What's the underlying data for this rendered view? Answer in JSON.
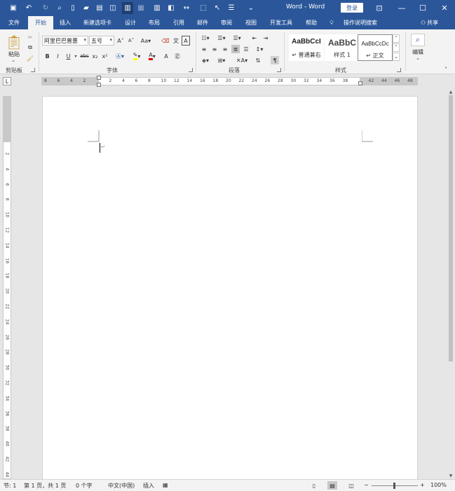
{
  "title_bar": {
    "title": "Word - Word",
    "login_label": "登录",
    "window_buttons": [
      "ribbon-display-options",
      "minimize",
      "maximize",
      "close"
    ]
  },
  "quick_access": [
    "save",
    "undo",
    "redo",
    "print-preview",
    "new",
    "open",
    "paste-special",
    "copy-format",
    "layout",
    "show-hide",
    "columns",
    "page-setup",
    "width",
    "select",
    "cursor",
    "list",
    "more"
  ],
  "tabs": {
    "file": "文件",
    "home": "开始",
    "insert": "插入",
    "new_tab": "新建选项卡",
    "design": "设计",
    "layout": "布局",
    "references": "引用",
    "mailings": "邮件",
    "review": "审阅",
    "view": "视图",
    "developer": "开发工具",
    "help": "帮助",
    "tell_me": "操作说明搜索",
    "share": "共享"
  },
  "ribbon": {
    "clipboard": {
      "label": "剪贴板",
      "paste_label": "粘贴"
    },
    "font": {
      "label": "字体",
      "font_name": "阿里巴巴普惠",
      "font_size": "五号",
      "case_label": "Aa",
      "bold": "B",
      "italic": "I",
      "underline": "U",
      "strike": "abc",
      "subscript": "x₂",
      "superscript": "x²",
      "font_color_letter": "A"
    },
    "paragraph": {
      "label": "段落"
    },
    "styles": {
      "label": "样式",
      "items": [
        {
          "preview": "AaBbCcI",
          "name": "↵ 普通兼右"
        },
        {
          "preview": "AaBbC",
          "name": "样式 1"
        },
        {
          "preview": "AaBbCcDc",
          "name": "↵ 正文"
        }
      ]
    },
    "editing": {
      "label": "编辑"
    }
  },
  "ruler": {
    "corner": "L",
    "ticks": [
      "8",
      "6",
      "4",
      "2",
      "",
      "2",
      "4",
      "6",
      "8",
      "10",
      "12",
      "14",
      "16",
      "18",
      "20",
      "22",
      "24",
      "26",
      "28",
      "30",
      "32",
      "34",
      "36",
      "38",
      "",
      "42",
      "44",
      "46",
      "48"
    ],
    "vticks": [
      "2",
      "4",
      "6",
      "8",
      "10",
      "12",
      "14",
      "16",
      "18",
      "20",
      "22",
      "24",
      "26",
      "28",
      "30",
      "32",
      "34",
      "36",
      "38",
      "40",
      "42",
      "44"
    ]
  },
  "status_bar": {
    "section": "节: 1",
    "page": "第 1 页，共 1 页",
    "words": "0 个字",
    "language": "中文(中国)",
    "mode": "插入",
    "zoom": "100%",
    "zoom_minus": "−",
    "zoom_plus": "+"
  }
}
